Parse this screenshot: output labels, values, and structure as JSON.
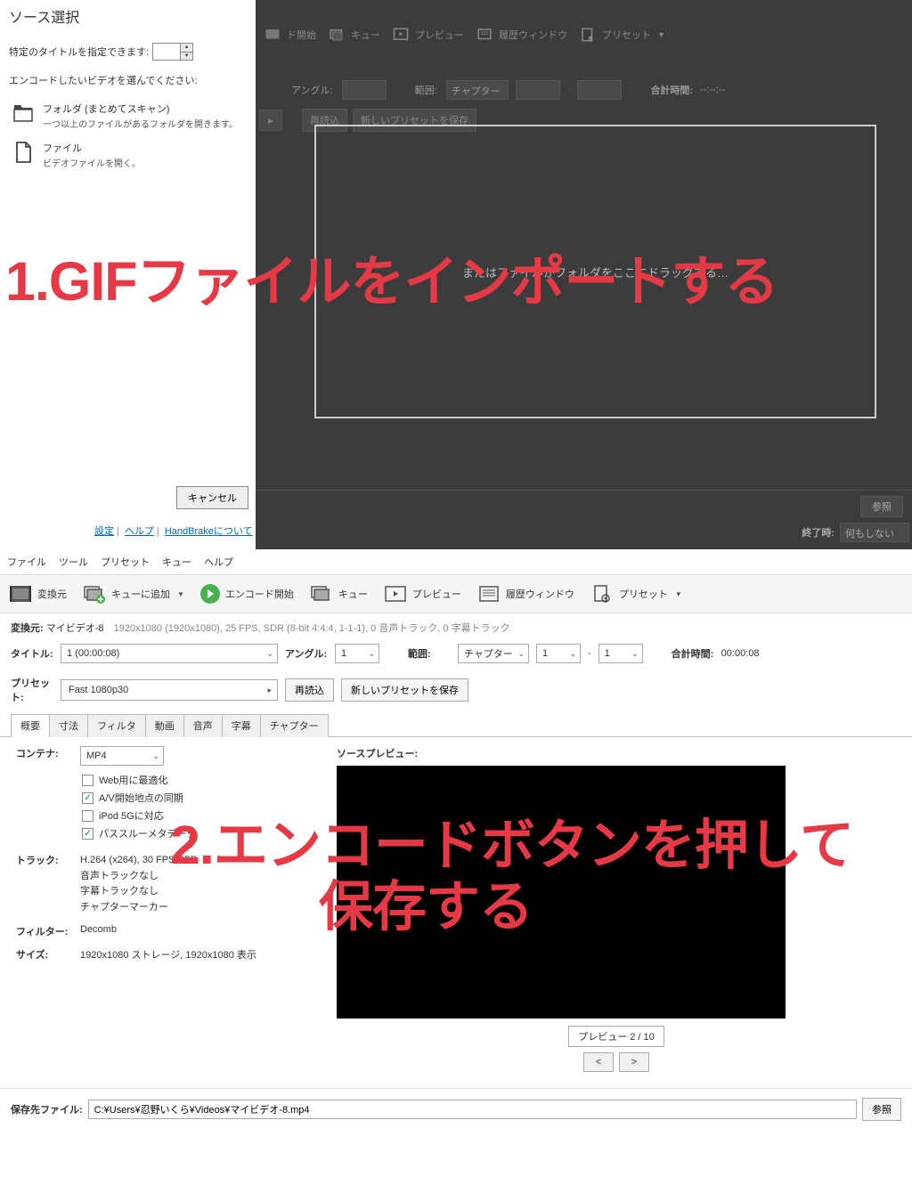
{
  "top": {
    "panel_title": "ソース選択",
    "specify_title_label": "特定のタイトルを指定できます:",
    "instruction": "エンコードしたいビデオを選んでください:",
    "folder_title": "フォルダ (まとめてスキャン)",
    "folder_sub": "一つ以上のファイルがあるフォルダを開きます。",
    "file_title": "ファイル",
    "file_sub": "ビデオファイルを開く。",
    "cancel": "キャンセル",
    "link_settings": "設定",
    "link_help": "ヘルプ",
    "link_about": "HandBrakeについて",
    "dim": {
      "d_start": "ド開始",
      "queue": "キュー",
      "preview": "プレビュー",
      "history": "履歴ウィンドウ",
      "preset": "プリセット",
      "angle": "アングル:",
      "range": "範囲:",
      "chapter": "チャプター",
      "total": "合計時間:",
      "total_val": "--:--:--",
      "reload": "再読込",
      "save_preset": "新しいプリセットを保存",
      "drop_hint": "またはファイルかフォルダをここにドラッグする…",
      "browse": "参照",
      "end_label": "終了時:",
      "end_val": "何もしない"
    }
  },
  "annotations": {
    "a1": "1.GIFファイルをインポートする",
    "a2": "2.エンコードボタンを押して",
    "a3": "保存する"
  },
  "bottom": {
    "menu": {
      "file": "ファイル",
      "tool": "ツール",
      "preset": "プリセット",
      "queue": "キュー",
      "help": "ヘルプ"
    },
    "toolbar": {
      "source": "変換元",
      "addqueue": "キューに追加",
      "encode": "エンコード開始",
      "queue": "キュー",
      "preview": "プレビュー",
      "history": "履歴ウィンドウ",
      "preset": "プリセット"
    },
    "source_label": "変換元:",
    "source_name": "マイビデオ-8",
    "source_info": "1920x1080 (1920x1080), 25 FPS, SDR (8-bit 4:4:4, 1-1-1), 0 音声トラック, 0 字幕トラック",
    "title_lbl": "タイトル:",
    "title_val": "1 (00:00:08)",
    "angle_lbl": "アングル:",
    "angle_val": "1",
    "range_lbl": "範囲:",
    "range_type": "チャプター",
    "range_from": "1",
    "range_to": "1",
    "total_lbl": "合計時間:",
    "total_val": "00:00:08",
    "preset_lbl": "プリセット:",
    "preset_val": "Fast 1080p30",
    "reload": "再読込",
    "save_preset": "新しいプリセットを保存",
    "tabs": {
      "summary": "概要",
      "dimensions": "寸法",
      "filter": "フィルタ",
      "video": "動画",
      "audio": "音声",
      "subtitle": "字幕",
      "chapter": "チャプター"
    },
    "container_lbl": "コンテナ:",
    "container_val": "MP4",
    "chk_web": "Web用に最適化",
    "chk_av": "A/V開始地点の同期",
    "chk_ipod": "iPod 5Gに対応",
    "chk_meta": "パススルーメタデータ",
    "tracks_lbl": "トラック:",
    "track_v": "H.264 (x264), 30 FPS PFR",
    "track_a": "音声トラックなし",
    "track_s": "字幕トラックなし",
    "track_c": "チャプターマーカー",
    "filter_lbl": "フィルター:",
    "filter_val": "Decomb",
    "size_lbl": "サイズ:",
    "size_val": "1920x1080 ストレージ, 1920x1080 表示",
    "preview_lbl": "ソースプレビュー:",
    "preview_page": "プレビュー 2 / 10",
    "prev": "<",
    "next": ">",
    "save_lbl": "保存先ファイル:",
    "save_val": "C:¥Users¥忍野いくら¥Videos¥マイビデオ-8.mp4",
    "browse": "参照"
  }
}
